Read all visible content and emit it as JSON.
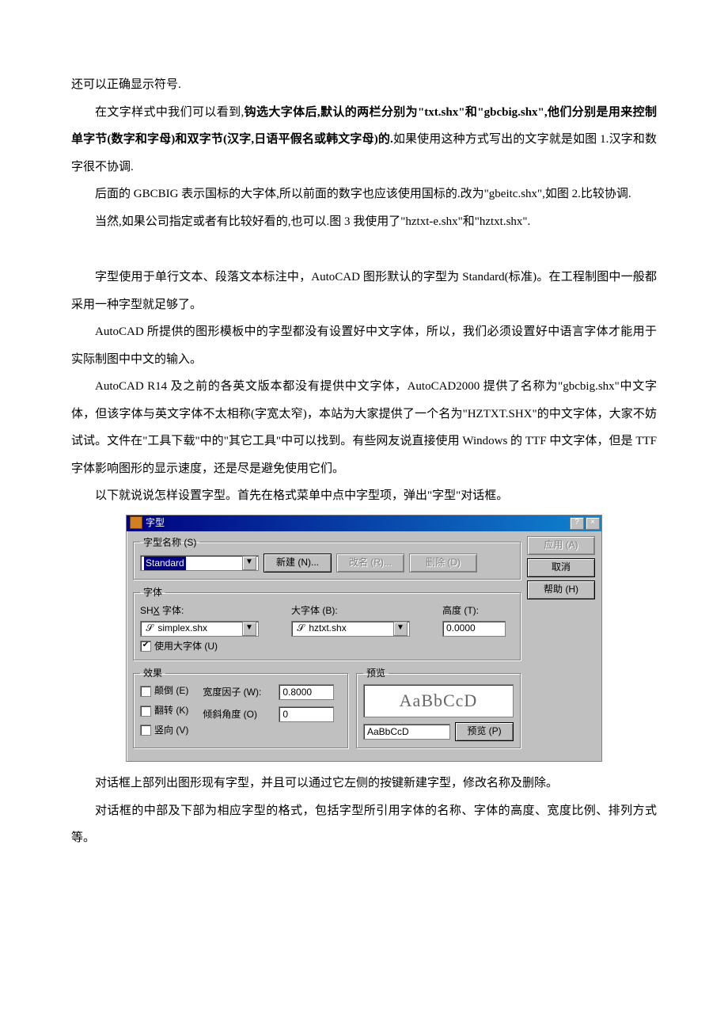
{
  "paragraphs": {
    "p0": "还可以正确显示符号.",
    "p1_a": "在文字样式中我们可以看到,",
    "p1_b": "钩选大字体后,默认的两栏分别为\"txt.shx\"和\"gbcbig.shx\",他们分别是用来控制单字节(数字和字母)和双字节(汉字,日语平假名或韩文字母)的.",
    "p1_c": "如果使用这种方式写出的文字就是如图 1.汉字和数字很不协调.",
    "p2": "后面的 GBCBIG 表示国标的大字体,所以前面的数字也应该使用国标的.改为\"gbeitc.shx\",如图 2.比较协调.",
    "p3": "当然,如果公司指定或者有比较好看的,也可以.图 3 我使用了\"hztxt-e.shx\"和\"hztxt.shx\".",
    "p4": "字型使用于单行文本、段落文本标注中，AutoCAD 图形默认的字型为 Standard(标准)。在工程制图中一般都采用一种字型就足够了。",
    "p5": "AutoCAD 所提供的图形模板中的字型都没有设置好中文字体，所以，我们必须设置好中语言字体才能用于实际制图中中文的输入。",
    "p6": "AutoCAD  R14 及之前的各英文版本都没有提供中文字体，AutoCAD2000 提供了名称为\"gbcbig.shx\"中文字体，但该字体与英文字体不太相称(字宽太窄)，本站为大家提供了一个名为\"HZTXT.SHX\"的中文字体，大家不妨试试。文件在\"工具下载\"中的\"其它工具\"中可以找到。有些网友说直接使用 Windows 的 TTF 中文字体，但是 TTF 字体影响图形的显示速度，还是尽是避免使用它们。",
    "p7": "以下就说说怎样设置字型。首先在格式菜单中点中字型项，弹出\"字型\"对话框。",
    "p8": "对话框上部列出图形现有字型，并且可以通过它左侧的按键新建字型，修改名称及删除。",
    "p9": "对话框的中部及下部为相应字型的格式，包括字型所引用字体的名称、字体的高度、宽度比例、排列方式等。"
  },
  "dialog": {
    "title": "字型",
    "help_btn": "?",
    "close_btn": "×",
    "groups": {
      "name_legend": "字型名称 (S)",
      "font_legend": "字体",
      "effect_legend": "效果",
      "preview_legend": "预览"
    },
    "name": {
      "combo_value": "Standard",
      "new_btn": "新建 (N)...",
      "rename_btn": "改名 (R)...",
      "delete_btn": "删除 (D)"
    },
    "font": {
      "shx_label_a": "SH",
      "shx_label_u": "X",
      "shx_label_b": " 字体:",
      "shx_value": "simplex.shx",
      "big_label": "大字体 (B):",
      "big_value": "hztxt.shx",
      "height_label": "高度 (T):",
      "height_value": "0.0000",
      "use_big_checkbox": "使用大字体 (U)"
    },
    "effects": {
      "upside": "颠倒 (E)",
      "flip": "翻转 (K)",
      "vertical": "竖向 (V)",
      "width_label": "宽度因子 (W):",
      "width_value": "0.8000",
      "oblique_label": "倾斜角度 (O)",
      "oblique_value": "0"
    },
    "preview": {
      "sample": "AaBbCcD",
      "input": "AaBbCcD",
      "button": "预览 (P)"
    },
    "side": {
      "apply": "应用 (A)",
      "cancel": "取消",
      "help": "帮助 (H)"
    }
  }
}
